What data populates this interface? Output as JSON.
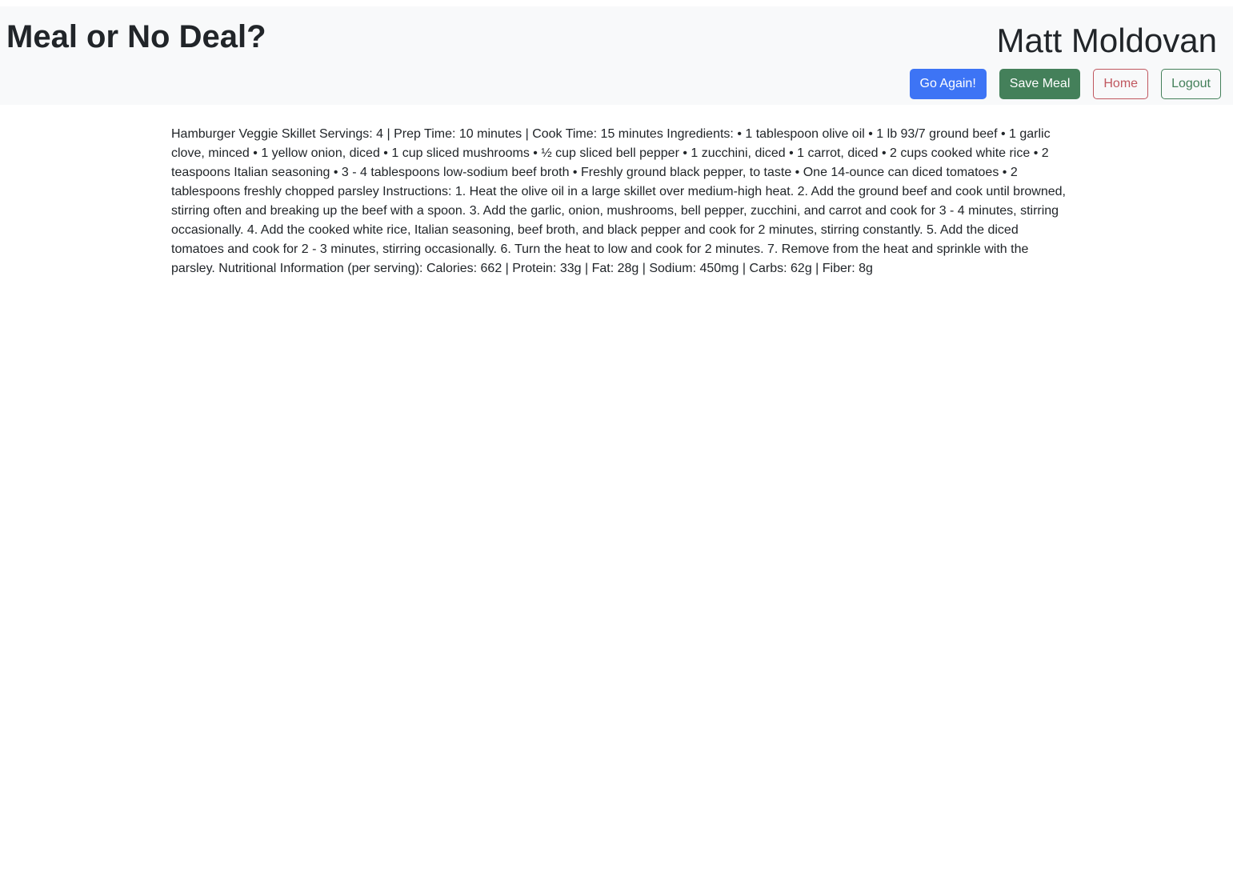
{
  "header": {
    "app_title": "Meal or No Deal?",
    "user_name": "Matt Moldovan",
    "buttons": {
      "go_again": "Go Again!",
      "save_meal": "Save Meal",
      "home": "Home",
      "logout": "Logout"
    }
  },
  "recipe": {
    "text": "Hamburger Veggie Skillet Servings: 4 | Prep Time: 10 minutes | Cook Time: 15 minutes Ingredients: • 1 tablespoon olive oil • 1 lb 93/7 ground beef • 1 garlic clove, minced • 1 yellow onion, diced • 1 cup sliced mushrooms • ½ cup sliced bell pepper • 1 zucchini, diced • 1 carrot, diced • 2 cups cooked white rice • 2 teaspoons Italian seasoning • 3 - 4 tablespoons low-sodium beef broth • Freshly ground black pepper, to taste • One 14-ounce can diced tomatoes • 2 tablespoons freshly chopped parsley Instructions: 1. Heat the olive oil in a large skillet over medium-high heat. 2. Add the ground beef and cook until browned, stirring often and breaking up the beef with a spoon. 3. Add the garlic, onion, mushrooms, bell pepper, zucchini, and carrot and cook for 3 - 4 minutes, stirring occasionally. 4. Add the cooked white rice, Italian seasoning, beef broth, and black pepper and cook for 2 minutes, stirring constantly. 5. Add the diced tomatoes and cook for 2 - 3 minutes, stirring occasionally. 6. Turn the heat to low and cook for 2 minutes. 7. Remove from the heat and sprinkle with the parsley. Nutritional Information (per serving): Calories: 662 | Protein: 33g | Fat: 28g | Sodium: 450mg | Carbs: 62g | Fiber: 8g"
  },
  "colors": {
    "header_bg": "#f8f9fa",
    "primary": "#3d74f5",
    "success": "#44805a",
    "danger": "#c0575f",
    "text": "#212529"
  }
}
